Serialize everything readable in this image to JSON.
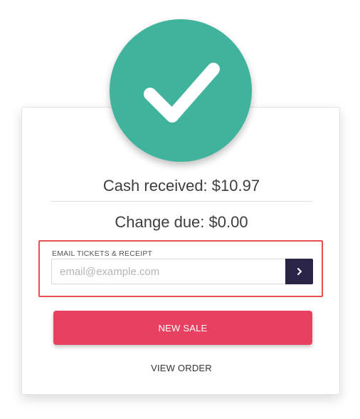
{
  "payment": {
    "cash_received": "Cash received: $10.97",
    "change_due": "Change due: $0.00"
  },
  "email_receipt": {
    "label": "EMAIL TICKETS & RECEIPT",
    "value": "",
    "placeholder": "email@example.com",
    "submit_icon": "chevron-right-icon"
  },
  "actions": {
    "new_sale_label": "NEW SALE",
    "view_order_label": "VIEW ORDER"
  },
  "colors": {
    "success": "#3fb39c",
    "primary_action": "#e84060",
    "submit_button": "#2a2547",
    "highlight_border": "#e8524a"
  },
  "icons": {
    "status": "checkmark-icon"
  }
}
